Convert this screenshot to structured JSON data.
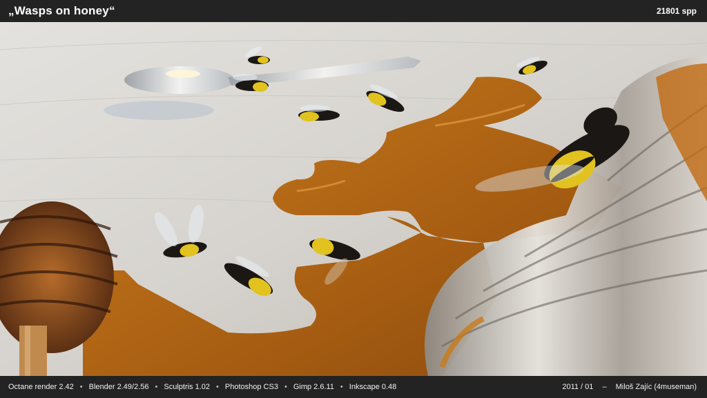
{
  "header": {
    "title": "„Wasps on honey“",
    "samples": "21801 spp"
  },
  "scene": {
    "description_icon": "honey-scene",
    "colors": {
      "table": "#d4d2cd",
      "honey": "#b56a16",
      "honey_dark": "#7a3f0c",
      "wasp_yellow": "#e1c21f",
      "wasp_black": "#1a1714",
      "spoon": "#cfd1d4",
      "glass": "#c7cbcd"
    }
  },
  "footer": {
    "tools": [
      "Octane render 2.42",
      "Blender 2.49/2.56",
      "Sculptris 1.02",
      "Photoshop CS3",
      "Gimp 2.6.11",
      "Inkscape 0.48"
    ],
    "separator": "•",
    "date": "2011 / 01",
    "dash": "–",
    "author": "Miloš Zajíc (4museman)"
  }
}
